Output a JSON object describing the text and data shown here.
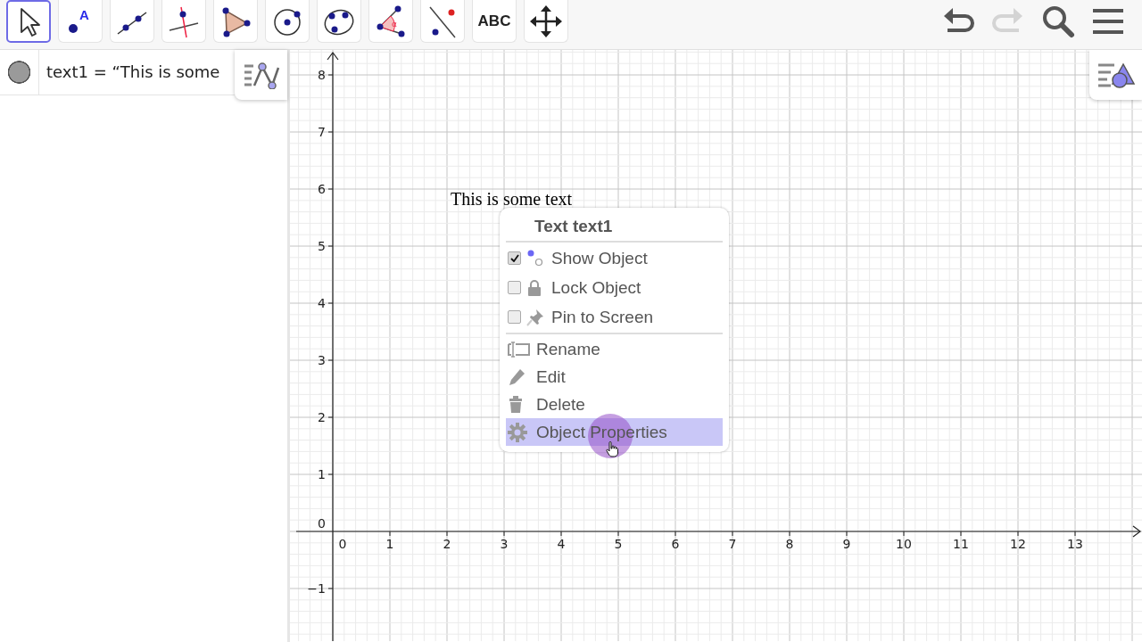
{
  "toolbar": {
    "tools": [
      {
        "kind": "move",
        "selected": true
      },
      {
        "kind": "point",
        "badge": "A",
        "selected": false
      },
      {
        "kind": "line",
        "selected": false
      },
      {
        "kind": "perpendicular",
        "selected": false
      },
      {
        "kind": "polygon",
        "selected": false
      },
      {
        "kind": "circle",
        "selected": false
      },
      {
        "kind": "conic",
        "selected": false
      },
      {
        "kind": "angle",
        "badge": "α",
        "selected": false
      },
      {
        "kind": "reflect",
        "selected": false
      },
      {
        "kind": "text",
        "label": "ABC",
        "selected": false
      },
      {
        "kind": "pan",
        "selected": false
      }
    ],
    "actions": [
      {
        "kind": "undo",
        "disabled": false
      },
      {
        "kind": "redo",
        "disabled": true
      },
      {
        "kind": "search",
        "disabled": false
      },
      {
        "kind": "menu",
        "disabled": false
      }
    ]
  },
  "algebra": {
    "items": [
      {
        "visible": true,
        "text": "text1 = “This is some"
      }
    ]
  },
  "graphics": {
    "x_labels": [
      "0",
      "1",
      "2",
      "3",
      "4",
      "5",
      "6",
      "7",
      "8",
      "9",
      "10",
      "11",
      "12",
      "13"
    ],
    "y_labels": [
      "8",
      "7",
      "6",
      "5",
      "4",
      "3",
      "2",
      "1",
      "0",
      "−1"
    ],
    "text_object": "This is some text"
  },
  "context_menu": {
    "title": "Text text1",
    "items": [
      {
        "kind": "checkbox",
        "label": "Show Object",
        "checked": true,
        "selected": false
      },
      {
        "kind": "checkbox",
        "label": "Lock Object",
        "checked": false,
        "selected": false
      },
      {
        "kind": "checkbox",
        "label": "Pin to Screen",
        "checked": false,
        "selected": false
      },
      {
        "kind": "action",
        "label": "Rename",
        "selected": false
      },
      {
        "kind": "action",
        "label": "Edit",
        "selected": false
      },
      {
        "kind": "action",
        "label": "Delete",
        "selected": false
      },
      {
        "kind": "action",
        "label": "Object Properties",
        "selected": true
      }
    ]
  }
}
